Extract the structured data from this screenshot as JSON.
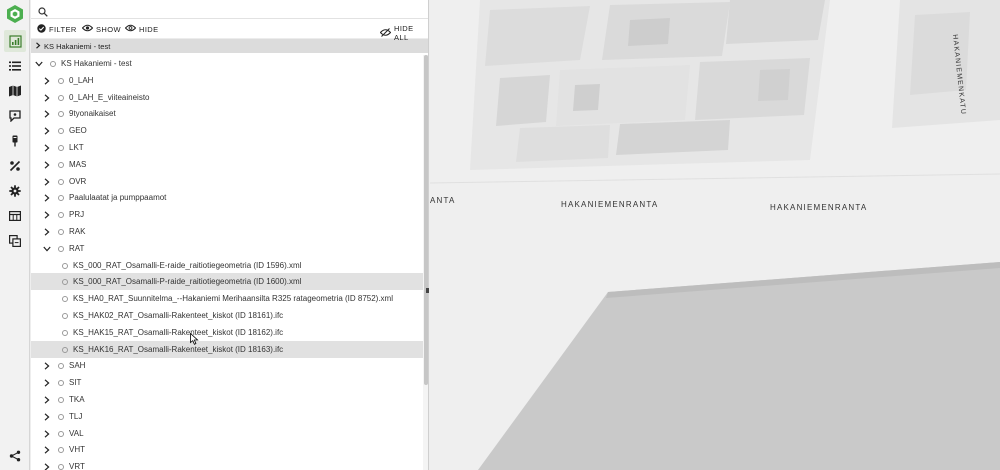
{
  "rail": {
    "items": [
      {
        "icon": "chart-icon",
        "active": true
      },
      {
        "icon": "list-icon"
      },
      {
        "icon": "map-icon"
      },
      {
        "icon": "comment-pin-icon"
      },
      {
        "icon": "probe-icon"
      },
      {
        "icon": "tools-icon"
      },
      {
        "icon": "gear-icon"
      },
      {
        "icon": "table-icon"
      },
      {
        "icon": "compare-icon"
      },
      {
        "icon": "share-icon"
      }
    ]
  },
  "search": {
    "value": "",
    "placeholder": ""
  },
  "toolbar": {
    "filter_label": "FILTER",
    "show_label": "SHOW",
    "hide_label": "HIDE",
    "hide_all_label": "HIDE ALL"
  },
  "breadcrumb": {
    "label": "KS Hakaniemi - test"
  },
  "tree": {
    "root": "KS Hakaniemi - test",
    "items": [
      {
        "label": "0_LAH",
        "level": 1,
        "expanded": false
      },
      {
        "label": "0_LAH_E_viiteaineisto",
        "level": 1,
        "expanded": false
      },
      {
        "label": "9tyonaikaiset",
        "level": 1,
        "expanded": false
      },
      {
        "label": "GEO",
        "level": 1,
        "expanded": false
      },
      {
        "label": "LKT",
        "level": 1,
        "expanded": false
      },
      {
        "label": "MAS",
        "level": 1,
        "expanded": false
      },
      {
        "label": "OVR",
        "level": 1,
        "expanded": false
      },
      {
        "label": "Paalulaatat ja pumppaamot",
        "level": 1,
        "expanded": false
      },
      {
        "label": "PRJ",
        "level": 1,
        "expanded": false
      },
      {
        "label": "RAK",
        "level": 1,
        "expanded": false
      },
      {
        "label": "RAT",
        "level": 1,
        "expanded": true
      },
      {
        "label": "KS_000_RAT_Osamalli-E-raide_raitiotiegeometria (ID 1596).xml",
        "level": 2,
        "highlight": false
      },
      {
        "label": "KS_000_RAT_Osamalli-P-raide_raitiotiegeometria (ID 1600).xml",
        "level": 2,
        "highlight": true
      },
      {
        "label": "KS_HA0_RAT_Suunnitelma_--Hakaniemi Merihaansilta R325 ratageometria (ID 8752).xml",
        "level": 2,
        "highlight": false
      },
      {
        "label": "KS_HAK02_RAT_Osamalli-Rakenteet_kiskot (ID 18161).ifc",
        "level": 2,
        "highlight": false
      },
      {
        "label": "KS_HAK15_RAT_Osamalli-Rakenteet_kiskot (ID 18162).ifc",
        "level": 2,
        "highlight": false
      },
      {
        "label": "KS_HAK16_RAT_Osamalli-Rakenteet_kiskot (ID 18163).ifc",
        "level": 2,
        "highlight": true
      },
      {
        "label": "SAH",
        "level": 1,
        "expanded": false
      },
      {
        "label": "SIT",
        "level": 1,
        "expanded": false
      },
      {
        "label": "TKA",
        "level": 1,
        "expanded": false
      },
      {
        "label": "TLJ",
        "level": 1,
        "expanded": false
      },
      {
        "label": "VAL",
        "level": 1,
        "expanded": false
      },
      {
        "label": "VHT",
        "level": 1,
        "expanded": false
      },
      {
        "label": "VRT",
        "level": 1,
        "expanded": false
      }
    ]
  },
  "map": {
    "street_labels": [
      "HAKANIEMENKATU",
      "ANTA",
      "HAKANIEMENRANTA",
      "HAKANIEMENRANTA"
    ]
  },
  "colors": {
    "logo": "#4caf50",
    "accent": "#3a7d2c"
  }
}
